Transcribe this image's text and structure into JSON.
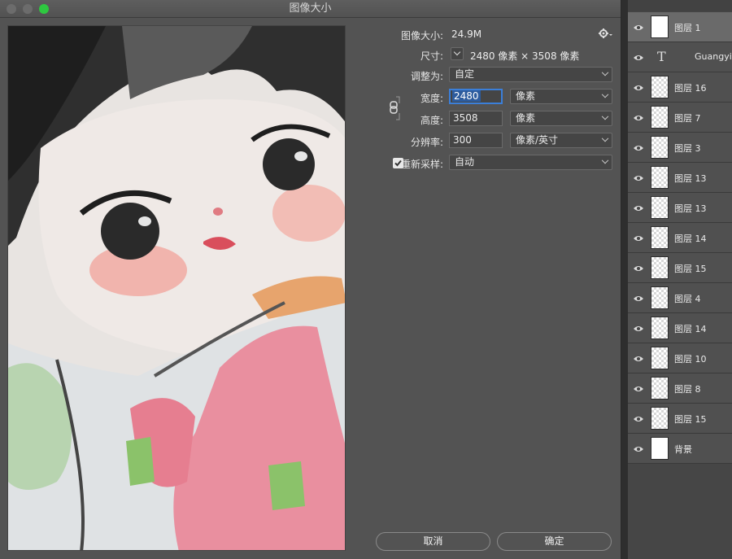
{
  "dialog": {
    "title": "图像大小",
    "image_size_label": "图像大小:",
    "image_size_value": "24.9M",
    "dimensions_label": "尺寸:",
    "dimensions_value": "2480 像素 × 3508 像素",
    "fit_to_label": "调整为:",
    "fit_to_value": "自定",
    "width_label": "宽度:",
    "width_value": "2480",
    "width_unit": "像素",
    "height_label": "高度:",
    "height_value": "3508",
    "height_unit": "像素",
    "resolution_label": "分辨率:",
    "resolution_value": "300",
    "resolution_unit": "像素/英寸",
    "resample_label": "重新采样:",
    "resample_value": "自动",
    "cancel_label": "取消",
    "ok_label": "确定",
    "accent_color": "#3b7fd9"
  },
  "layers": {
    "items": [
      {
        "name": "图层 1",
        "selected": true
      },
      {
        "name": "Guangying",
        "type": "text"
      },
      {
        "name": "图层 16"
      },
      {
        "name": "图层 7"
      },
      {
        "name": "图层 3"
      },
      {
        "name": "图层 13"
      },
      {
        "name": "图层 13"
      },
      {
        "name": "图层 14"
      },
      {
        "name": "图层 15"
      },
      {
        "name": "图层 4"
      },
      {
        "name": "图层 14"
      },
      {
        "name": "图层 10"
      },
      {
        "name": "图层 8"
      },
      {
        "name": "图层 15"
      },
      {
        "name": "背景"
      }
    ]
  }
}
